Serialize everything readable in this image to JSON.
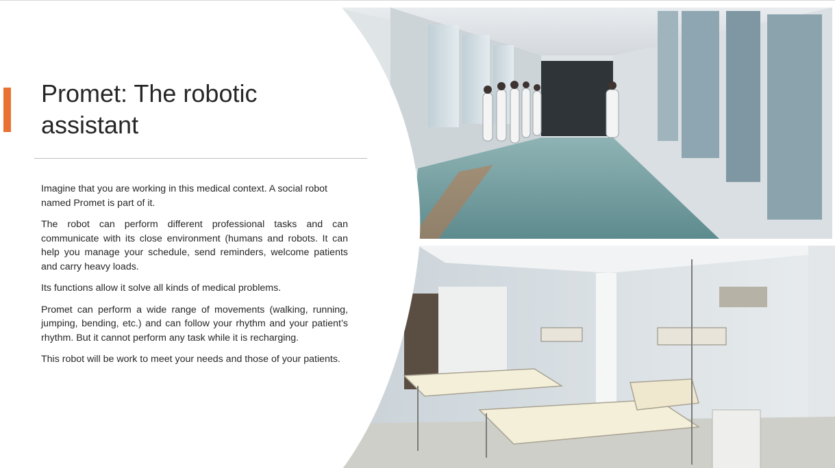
{
  "slide": {
    "title": "Promet: The robotic assistant",
    "accent_color": "#E97132",
    "paragraphs": [
      "Imagine that you are working in this medical context. A social robot named Promet is part of it.",
      "The robot can perform different professional tasks and can communicate with its close environment (humans and robots. It can help you manage your schedule, send reminders, welcome patients and carry heavy loads.",
      "Its functions allow it solve all kinds of medical problems.",
      "Promet can perform a wide range of movements (walking, running, jumping, bending, etc.) and can follow your rhythm and your patient’s rhythm. But it cannot perform any task while it is recharging.",
      "This robot will be work to meet your needs and those of your patients."
    ]
  },
  "images": {
    "top": {
      "icon": "hospital-corridor-photo"
    },
    "bottom": {
      "icon": "hospital-ward-beds-photo"
    }
  }
}
